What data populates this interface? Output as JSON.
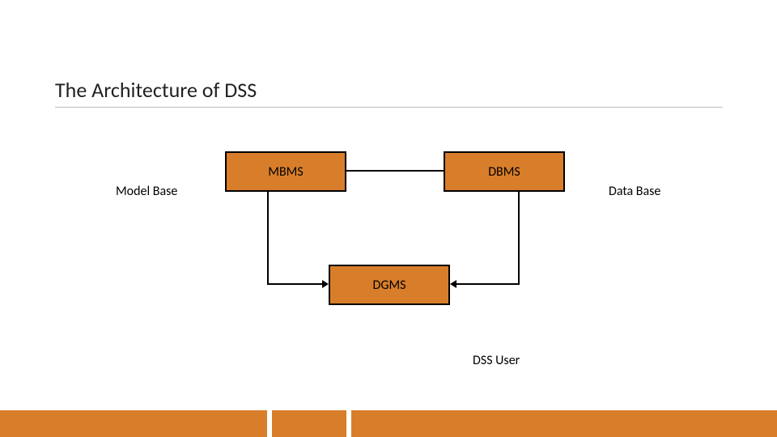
{
  "title": "The Architecture of DSS",
  "nodes": {
    "mbms": "MBMS",
    "dbms": "DBMS",
    "dgms": "DGMS"
  },
  "labels": {
    "model_base": "Model Base",
    "data_base": "Data Base",
    "dss_user": "DSS User"
  },
  "colors": {
    "accent": "#D87E2A"
  }
}
